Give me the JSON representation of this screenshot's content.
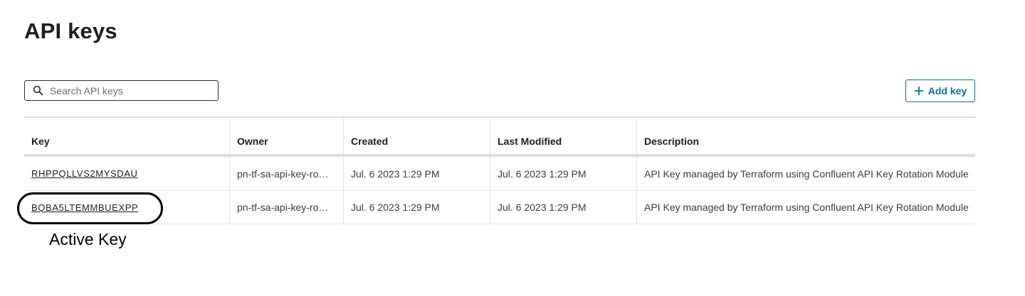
{
  "page": {
    "title": "API keys"
  },
  "search": {
    "placeholder": "Search API keys",
    "value": "",
    "icon": "search-icon"
  },
  "toolbar": {
    "add_label": "Add key",
    "add_icon": "plus-icon",
    "accent_color": "#0f6f8f"
  },
  "table": {
    "columns": [
      "Key",
      "Owner",
      "Created",
      "Last Modified",
      "Description"
    ],
    "rows": [
      {
        "key": "RHPPQLLVS2MYSDAU",
        "owner": "pn-tf-sa-api-key-ro…",
        "created": "Jul. 6 2023 1:29 PM",
        "modified": "Jul. 6 2023 1:29 PM",
        "description": "API Key managed by Terraform using Confluent API Key Rotation Module"
      },
      {
        "key": "BQBA5LTEMMBUEXPP",
        "owner": "pn-tf-sa-api-key-ro…",
        "created": "Jul. 6 2023 1:29 PM",
        "modified": "Jul. 6 2023 1:29 PM",
        "description": "API Key managed by Terraform using Confluent API Key Rotation Module"
      }
    ]
  },
  "annotation": {
    "label": "Active Key"
  }
}
